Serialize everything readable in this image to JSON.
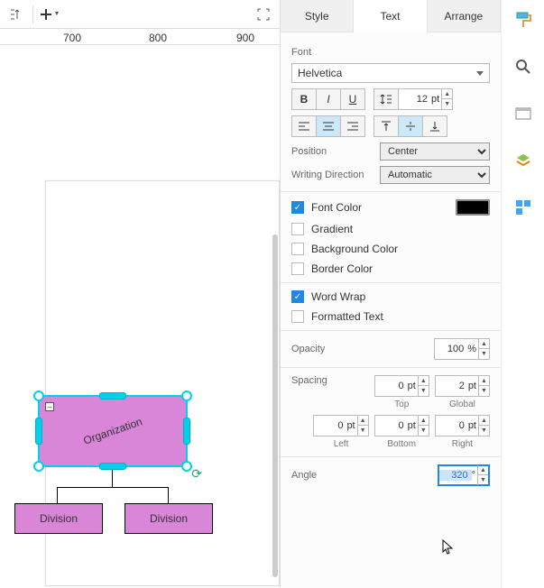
{
  "ruler": {
    "m1": "700",
    "m2": "800",
    "m3": "900"
  },
  "shapes": {
    "org": "Organization",
    "div1": "Division",
    "div2": "Division"
  },
  "tabs": {
    "style": "Style",
    "text": "Text",
    "arrange": "Arrange"
  },
  "font": {
    "label": "Font",
    "family": "Helvetica",
    "size": "12",
    "unit": "pt"
  },
  "position": {
    "label": "Position",
    "value": "Center"
  },
  "writing": {
    "label": "Writing Direction",
    "value": "Automatic"
  },
  "checks": {
    "fontcolor": "Font Color",
    "gradient": "Gradient",
    "bgcolor": "Background Color",
    "bordercolor": "Border Color",
    "wordwrap": "Word Wrap",
    "formatted": "Formatted Text"
  },
  "opacity": {
    "label": "Opacity",
    "value": "100",
    "unit": "%"
  },
  "spacing": {
    "label": "Spacing",
    "top": "0",
    "global": "2",
    "left": "0",
    "bottom": "0",
    "right": "0",
    "unit": "pt",
    "cap_top": "Top",
    "cap_global": "Global",
    "cap_left": "Left",
    "cap_bottom": "Bottom",
    "cap_right": "Right"
  },
  "angle": {
    "label": "Angle",
    "value": "320",
    "unit": "°"
  }
}
